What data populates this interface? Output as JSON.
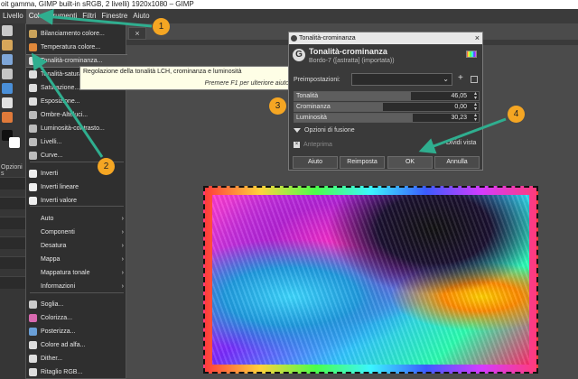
{
  "window": {
    "title": "oit gamma, GIMP built-in sRGB, 2 livelli) 1920x1080 – GIMP"
  },
  "menubar": {
    "items": [
      {
        "label": "Livello",
        "active": false
      },
      {
        "label": "Colori",
        "active": true
      },
      {
        "label": "rumenti",
        "active": false
      },
      {
        "label": "Filtri",
        "active": false
      },
      {
        "label": "Finestre",
        "active": false
      },
      {
        "label": "Aiuto",
        "active": false
      }
    ]
  },
  "left_panel": {
    "label": "Opzioni s"
  },
  "canvas_tab": {
    "label": "×"
  },
  "colors_menu": {
    "items": [
      {
        "label": "Bilanciamento colore...",
        "icon": "color-balance-icon",
        "icon_color": "#c9a25a"
      },
      {
        "label": "Temperatura colore...",
        "icon": "temperature-icon",
        "icon_color": "#e0883a"
      },
      {
        "label": "Tonalità-crominanza...",
        "icon": "gimp-gegl-icon",
        "icon_color": "#dddddd",
        "selected": true
      },
      {
        "label": "Tonalità-saturazione...",
        "icon": "gimp-gegl-icon",
        "icon_color": "#dddddd"
      },
      {
        "label": "Saturazione...",
        "icon": "gimp-gegl-icon",
        "icon_color": "#dddddd"
      },
      {
        "label": "Esposizione...",
        "icon": "gimp-gegl-icon",
        "icon_color": "#dddddd"
      },
      {
        "label": "Ombre-Alteluci...",
        "icon": "shadows-icon",
        "icon_color": "#bbbbbb"
      },
      {
        "label": "Luminosità-contrasto...",
        "icon": "brightness-icon",
        "icon_color": "#bbbbbb"
      },
      {
        "label": "Livelli...",
        "icon": "levels-icon",
        "icon_color": "#bbbbbb"
      },
      {
        "label": "Curve...",
        "icon": "curves-icon",
        "icon_color": "#bbbbbb"
      },
      {
        "label": "Inverti",
        "icon": "invert-icon",
        "icon_color": "#eeeeee"
      },
      {
        "label": "Inverti lineare",
        "icon": "invert-icon",
        "icon_color": "#eeeeee"
      },
      {
        "label": "Inverti valore",
        "icon": "invert-icon",
        "icon_color": "#eeeeee"
      },
      {
        "label": "Auto",
        "submenu": true
      },
      {
        "label": "Componenti",
        "submenu": true
      },
      {
        "label": "Desatura",
        "submenu": true
      },
      {
        "label": "Mappa",
        "submenu": true
      },
      {
        "label": "Mappatura tonale",
        "submenu": true
      },
      {
        "label": "Informazioni",
        "submenu": true
      },
      {
        "label": "Soglia...",
        "icon": "threshold-icon",
        "icon_color": "#cccccc"
      },
      {
        "label": "Colorizza...",
        "icon": "colorize-icon",
        "icon_color": "#d86ab0"
      },
      {
        "label": "Posterizza...",
        "icon": "posterize-icon",
        "icon_color": "#6aa0d8"
      },
      {
        "label": "Colore ad alfa...",
        "icon": "color-to-alpha-icon",
        "icon_color": "#dddddd"
      },
      {
        "label": "Dither...",
        "icon": "gimp-gegl-icon",
        "icon_color": "#dddddd"
      },
      {
        "label": "Ritaglio RGB...",
        "icon": "rgb-clip-icon",
        "icon_color": "#dddddd"
      }
    ],
    "submenu_arrow": "›"
  },
  "tooltip": {
    "text": "Regolazione della tonalità LCH, crominanza e luminosità",
    "hint": "Premere F1 per ulteriore aiuto"
  },
  "dialog": {
    "window_title": "Tonalità-crominanza",
    "close": "×",
    "heading": "Tonalità-crominanza",
    "subheading": "Bordo-7 ([astratta] (importata))",
    "logo": "G",
    "presets_label": "Preimpostazioni:",
    "presets_value": "",
    "presets_chevron": "⌄",
    "presets_add": "+",
    "sliders": [
      {
        "label": "Tonalità",
        "value": "46,05",
        "fill_fraction": 0.63
      },
      {
        "label": "Crominanza",
        "value": "0,00",
        "fill_fraction": 0.48
      },
      {
        "label": "Luminosità",
        "value": "30,23",
        "fill_fraction": 0.64
      }
    ],
    "blend_options": "Opzioni di fusione",
    "preview": "Anteprima",
    "split_view": "Dividi vista",
    "buttons": {
      "help": "Aiuto",
      "reset": "Reimposta",
      "ok": "OK",
      "cancel": "Annulla"
    }
  },
  "annotations": {
    "accent_color": "#2fae8f",
    "badge_color": "#f5a623",
    "badges": [
      "1",
      "2",
      "3",
      "4"
    ]
  }
}
